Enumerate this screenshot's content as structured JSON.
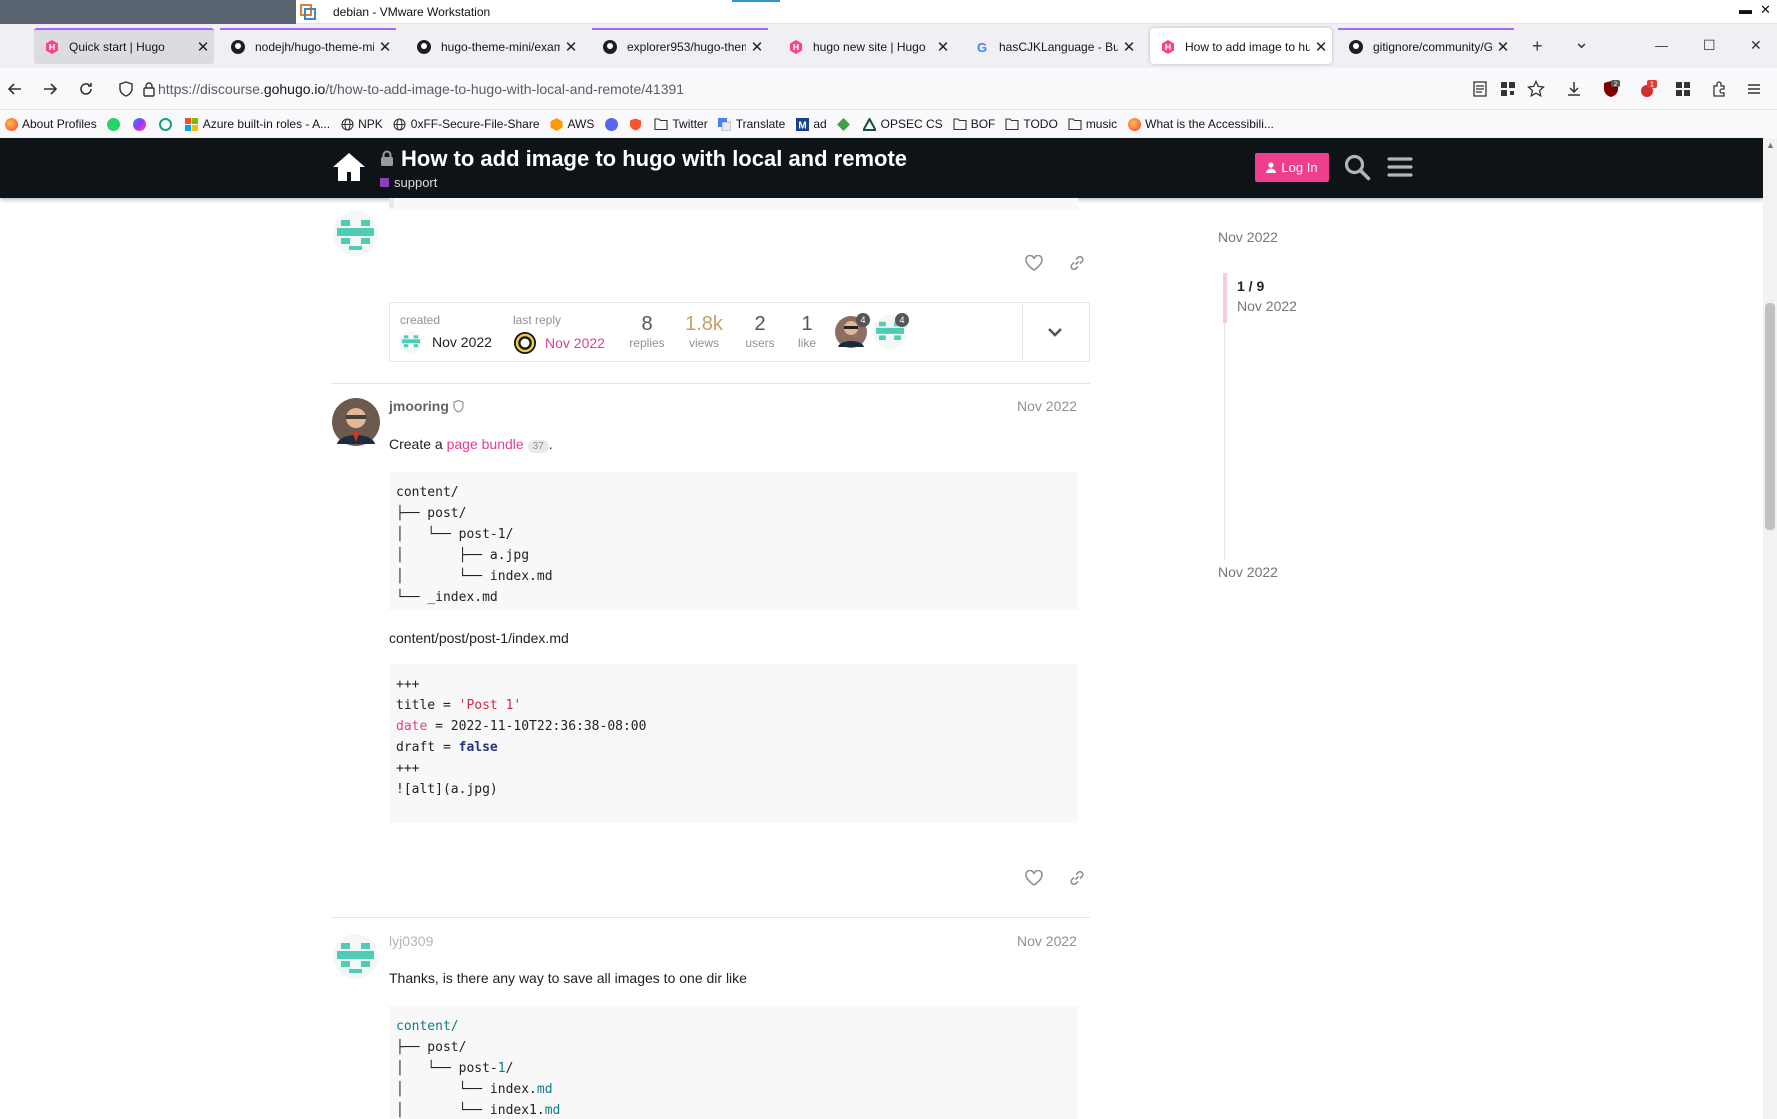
{
  "window": {
    "title": "debian - VMware Workstation",
    "controls": {
      "minimize": "▬",
      "close": "✕"
    }
  },
  "tabs": [
    {
      "label": "Quick start | Hugo",
      "icon": "hugo-icon"
    },
    {
      "label": "nodejh/hugo-theme-mi",
      "icon": "github-icon"
    },
    {
      "label": "hugo-theme-mini/exam",
      "icon": "github-icon"
    },
    {
      "label": "explorer953/hugo-them",
      "icon": "github-icon"
    },
    {
      "label": "hugo new site | Hugo",
      "icon": "hugo-icon"
    },
    {
      "label": "hasCJKLanguage - Busc",
      "icon": "google-icon"
    },
    {
      "label": "How to add image to hu",
      "icon": "hugo-icon",
      "active": true
    },
    {
      "label": "gitignore/community/G",
      "icon": "github-icon"
    }
  ],
  "tab_controls": {
    "new_tab": "+",
    "list_tabs": "⌄",
    "minimize": "—",
    "maximize": "☐",
    "close": "✕"
  },
  "address": {
    "prefix": "https://discourse.",
    "host": "gohugo.io",
    "path": "/t/how-to-add-image-to-hugo-with-local-and-remote/41391"
  },
  "extension_badges": {
    "ublock": "2",
    "other": "1"
  },
  "bookmarks": [
    {
      "label": "About Profiles",
      "icon": "firefox-icon"
    },
    {
      "label": "",
      "icon": "whatsapp-icon"
    },
    {
      "label": "",
      "icon": "messenger-icon"
    },
    {
      "label": "",
      "icon": "chatgpt-icon"
    },
    {
      "label": "Azure built-in roles - A...",
      "icon": "microsoft-icon"
    },
    {
      "label": "NPK",
      "icon": "globe-icon"
    },
    {
      "label": "0xFF-Secure-File-Share",
      "icon": "globe-icon"
    },
    {
      "label": "AWS",
      "icon": "aws-icon"
    },
    {
      "label": "",
      "icon": "discord-icon"
    },
    {
      "label": "",
      "icon": "shield-icon"
    },
    {
      "label": "Twitter",
      "icon": "folder-icon"
    },
    {
      "label": "Translate",
      "icon": "translate-icon"
    },
    {
      "label": "ad",
      "icon": "m-icon"
    },
    {
      "label": "",
      "icon": "diamond-icon"
    },
    {
      "label": "OPSEC CS",
      "icon": "triangle-icon"
    },
    {
      "label": "BOF",
      "icon": "folder-icon"
    },
    {
      "label": "TODO",
      "icon": "folder-icon"
    },
    {
      "label": "music",
      "icon": "folder-icon"
    },
    {
      "label": "What is the Accessibili...",
      "icon": "firefox-icon"
    }
  ],
  "site": {
    "topic_title": "How to add image to hugo with local and remote",
    "category": "support",
    "login_label": "Log In"
  },
  "topic_map": {
    "created_label": "created",
    "created_date": "Nov 2022",
    "last_reply_label": "last reply",
    "last_reply_date": "Nov 2022",
    "replies": "8",
    "replies_label": "replies",
    "views": "1.8k",
    "views_label": "views",
    "users": "2",
    "users_label": "users",
    "likes": "1",
    "likes_label": "like",
    "participant_counts": [
      "4",
      "4"
    ]
  },
  "posts": [
    {
      "author": "jmooring",
      "date": "Nov 2022",
      "text_before": "Create a ",
      "link": "page bundle",
      "link_clicks": "37",
      "text_after": ".",
      "code1": "content/\n├── post/\n│   └── post-1/\n│       ├── a.jpg\n│       └── index.md\n└── _index.md",
      "filename": "content/post/post-1/index.md",
      "code2_lines": {
        "delim": "+++",
        "title_key": "title = ",
        "title_val": "'Post 1'",
        "date_key": "date",
        "date_val": " = 2022-11-10T22:36:38-08:00",
        "draft_key": "draft = ",
        "draft_val": "false",
        "image": "![alt](a.jpg)"
      }
    },
    {
      "author": "lyj0309",
      "date": "Nov 2022",
      "text": "Thanks, is there any way to save all images to one dir like",
      "code_lines": {
        "l1": "content/",
        "l2": "├── post/",
        "l3a": "│   └── post-",
        "l3b": "1",
        "l3c": "/",
        "l4a": "│       └── index.",
        "l4b": "md",
        "l5a": "│       └── index1.",
        "l5b": "md"
      }
    }
  ],
  "timeline": {
    "top_date": "Nov 2022",
    "position": "1 / 9",
    "position_date": "Nov 2022",
    "bottom_date": "Nov 2022"
  },
  "colors": {
    "header_bg": "#0e1318",
    "accent_pink": "#ee3e8d",
    "category": "#8c3fb8",
    "bot_avatar": "#4ecdb4"
  }
}
